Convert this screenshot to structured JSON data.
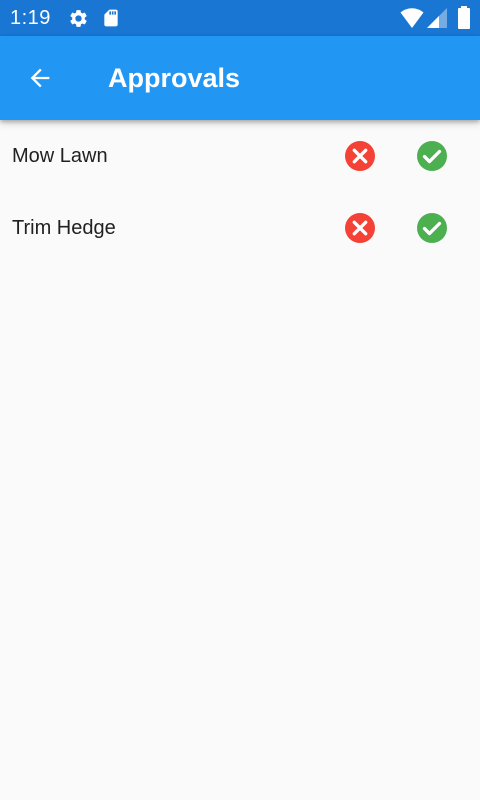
{
  "status_bar": {
    "time": "1:19",
    "icons": [
      "gear-icon",
      "sd-card-icon",
      "wifi-icon",
      "cell-signal-icon",
      "battery-icon"
    ]
  },
  "app_bar": {
    "title": "Approvals",
    "back_icon": "arrow-back-icon"
  },
  "approvals": [
    {
      "label": "Mow Lawn",
      "reject_icon": "cancel-icon",
      "approve_icon": "check-circle-icon"
    },
    {
      "label": "Trim Hedge",
      "reject_icon": "cancel-icon",
      "approve_icon": "check-circle-icon"
    }
  ],
  "colors": {
    "status_bar": "#1976d2",
    "app_bar": "#2196f3",
    "reject": "#f44336",
    "approve": "#4caf50",
    "background": "#fafafa"
  }
}
